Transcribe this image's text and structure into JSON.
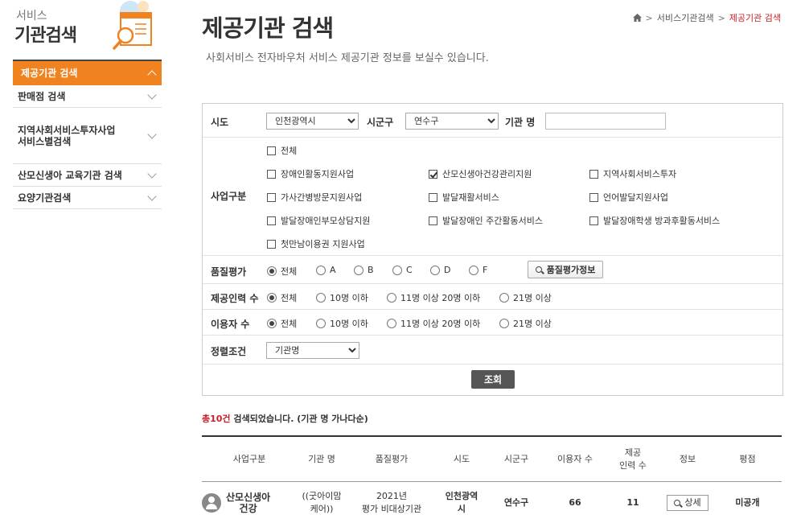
{
  "sidebar": {
    "logo_small": "서비스",
    "logo_big": "기관검색",
    "items": [
      {
        "label": "제공기관 검색",
        "active": true
      },
      {
        "label": "판매점 검색"
      },
      {
        "label": "지역사회서비스투자사업\n서비스별검색"
      },
      {
        "label": "산모신생아 교육기관 검색"
      },
      {
        "label": "요양기관검색"
      }
    ]
  },
  "header": {
    "title": "제공기관 검색",
    "subtitle": "사회서비스 전자바우처 서비스 제공기관 정보를 보실수 있습니다.",
    "breadcrumb": [
      "서비스기관검색",
      "제공기관 검색"
    ]
  },
  "search": {
    "sido_label": "시도",
    "sido_value": "인천광역시",
    "sigungu_label": "시군구",
    "sigungu_value": "연수구",
    "name_label": "기관 명",
    "business_label": "사업구분",
    "business_options": [
      {
        "label": "전체",
        "checked": false
      },
      {
        "label": "장애인활동지원사업",
        "checked": false
      },
      {
        "label": "산모신생아건강관리지원",
        "checked": true
      },
      {
        "label": "지역사회서비스투자",
        "checked": false
      },
      {
        "label": "가사간병방문지원사업",
        "checked": false
      },
      {
        "label": "발달재활서비스",
        "checked": false
      },
      {
        "label": "언어발달지원사업",
        "checked": false
      },
      {
        "label": "발달장애인부모상담지원",
        "checked": false
      },
      {
        "label": "발달장애인 주간활동서비스",
        "checked": false
      },
      {
        "label": "발달장애학생 방과후활동서비스",
        "checked": false
      },
      {
        "label": "첫만남이용권 지원사업",
        "checked": false
      }
    ],
    "quality_label": "품질평가",
    "quality_options": [
      "전체",
      "A",
      "B",
      "C",
      "D",
      "F"
    ],
    "quality_info_button": "품질평가정보",
    "staff_label": "제공인력 수",
    "staff_options": [
      "전체",
      "10명 이하",
      "11명 이상 20명 이하",
      "21명 이상"
    ],
    "users_label": "이용자 수",
    "users_options": [
      "전체",
      "10명 이하",
      "11명 이상 20명 이하",
      "21명 이상"
    ],
    "sort_label": "정렬조건",
    "sort_value": "기관명",
    "search_button": "조회"
  },
  "results": {
    "count_text": "총10건",
    "count_suffix": " 검색되었습니다. (기관 명 가나다순)",
    "columns": [
      "사업구분",
      "기관 명",
      "품질평가",
      "시도",
      "시군구",
      "이용자 수",
      "제공\n인력 수",
      "정보",
      "평점"
    ],
    "rows": [
      {
        "business": "산모신생아\n건강",
        "name": "((굿아이맘\n케어))",
        "quality": "2021년\n평가 비대상기관",
        "sido": "인천광역\n시",
        "sigungu": "연수구",
        "users": "66",
        "staff": "11",
        "info_button": "상세",
        "rating": "미공개"
      }
    ]
  }
}
